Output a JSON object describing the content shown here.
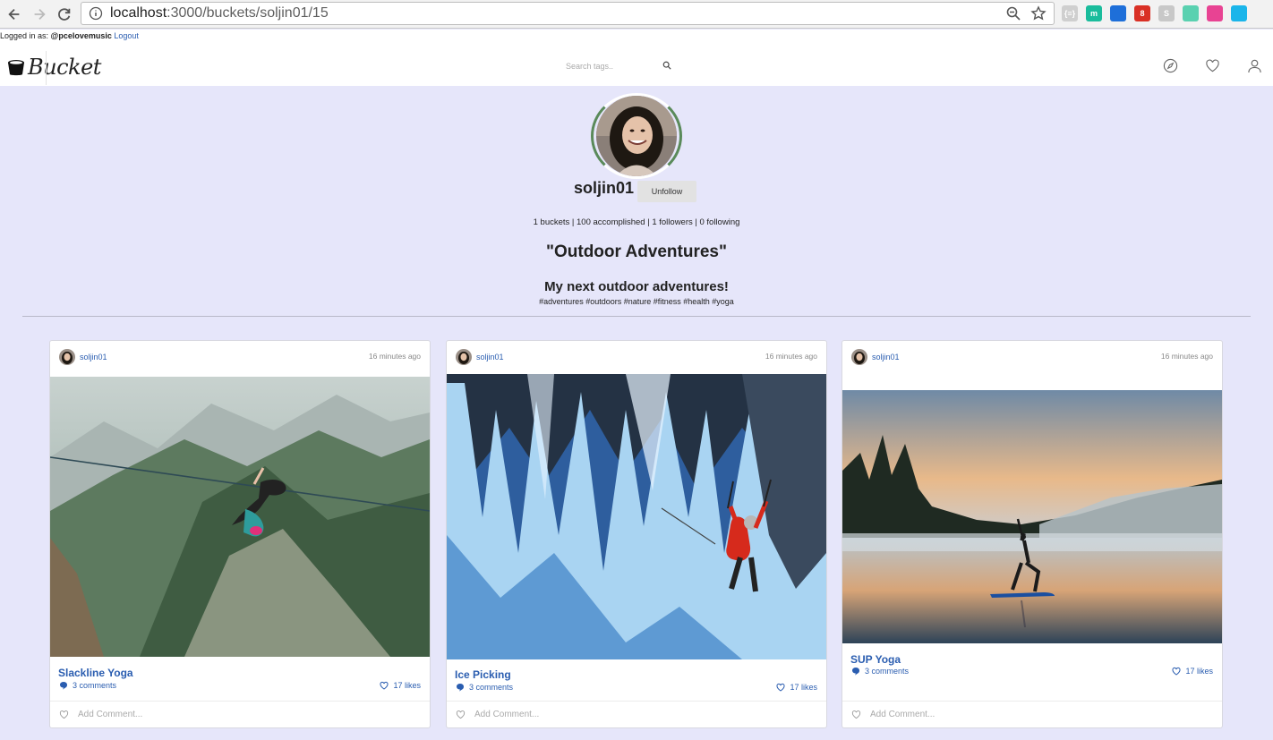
{
  "browser": {
    "url_host": "localhost",
    "url_path": ":3000/buckets/soljin01/15",
    "extensions": [
      {
        "name": "json-icon",
        "label": "{≡}",
        "color": "#cfcfcf"
      },
      {
        "name": "m-icon",
        "label": "m",
        "color": "#1abc9c"
      },
      {
        "name": "window-icon",
        "label": "",
        "color": "#1e6fd9"
      },
      {
        "name": "todoist-icon",
        "label": "8",
        "color": "#d93025"
      },
      {
        "name": "skype-icon",
        "label": "S",
        "color": "#c8c8c8"
      },
      {
        "name": "waveform-icon",
        "label": "",
        "color": "#5ad1b0"
      },
      {
        "name": "color-wheel-icon",
        "label": "",
        "color": "#e84393"
      },
      {
        "name": "eyedropper-icon",
        "label": "",
        "color": "#1ab5ea"
      }
    ]
  },
  "login": {
    "prefix": "Logged in as: ",
    "handle": "@pcelovemusic",
    "logout": "Logout"
  },
  "header": {
    "brand": "Bucket",
    "search_placeholder": "Search tags..",
    "icons": [
      "compass-icon",
      "heart-icon",
      "user-icon"
    ]
  },
  "profile": {
    "username": "soljin01",
    "follow_button": "Unfollow",
    "stats": "1 buckets | 100 accomplished | 1 followers | 0 following"
  },
  "bucket": {
    "title": "\"Outdoor Adventures\"",
    "description": "My next outdoor adventures!",
    "tags": "#adventures #outdoors #nature #fitness #health #yoga"
  },
  "cards": [
    {
      "username": "soljin01",
      "time": "16 minutes ago",
      "title": "Slackline Yoga",
      "comments": "3 comments",
      "likes": "17 likes",
      "comment_placeholder": "Add Comment..."
    },
    {
      "username": "soljin01",
      "time": "16 minutes ago",
      "title": "Ice Picking",
      "comments": "3 comments",
      "likes": "17 likes",
      "comment_placeholder": "Add Comment..."
    },
    {
      "username": "soljin01",
      "time": "16 minutes ago",
      "title": "SUP Yoga",
      "comments": "3 comments",
      "likes": "17 likes",
      "comment_placeholder": "Add Comment..."
    }
  ],
  "colors": {
    "page_bg": "#e6e6fa",
    "link": "#2a5db0"
  }
}
